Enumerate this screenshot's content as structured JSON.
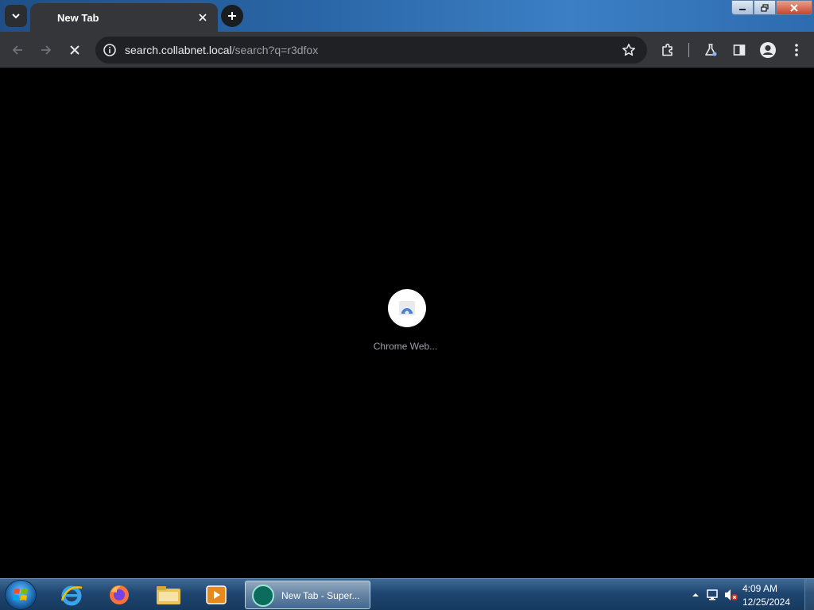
{
  "browser": {
    "active_tab_title": "New Tab",
    "url_host": "search.collabnet.local",
    "url_path": "/search?q=r3dfox"
  },
  "content": {
    "loading_label": "Chrome Web..."
  },
  "taskbar": {
    "running_app_label": "New Tab - Super...",
    "clock_time": "4:09 AM",
    "clock_date": "12/25/2024"
  },
  "colors": {
    "tab_strip": "#2a67a8",
    "toolbar": "#35363a",
    "omnibox": "#202124",
    "content_bg": "#000000"
  },
  "icons": [
    "tab-search-icon",
    "close-icon",
    "plus-icon",
    "back-icon",
    "forward-icon",
    "stop-icon",
    "info-icon",
    "star-icon",
    "extensions-icon",
    "labs-flask-icon",
    "side-panel-icon",
    "profile-icon",
    "menu-kebab-icon",
    "web-store-icon",
    "start-orb-icon",
    "ie-icon",
    "firefox-icon",
    "explorer-folder-icon",
    "media-player-icon",
    "speaker-muted-icon",
    "network-icon",
    "tray-arrow-icon"
  ]
}
